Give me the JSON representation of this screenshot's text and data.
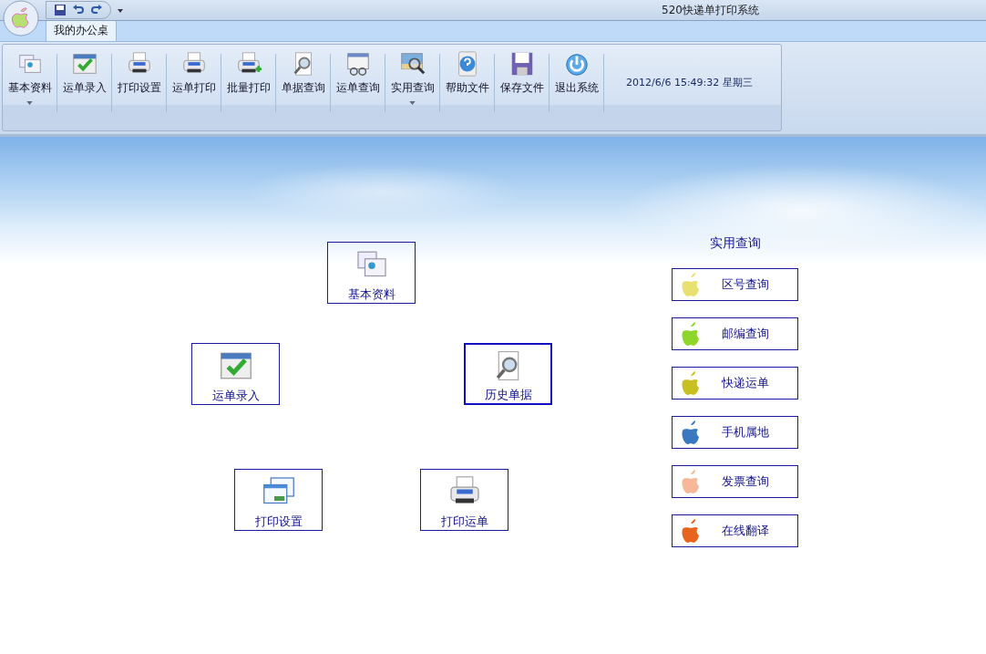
{
  "window": {
    "title": "520快递单打印系统"
  },
  "tabs": [
    {
      "label": "我的办公桌",
      "selected": true
    }
  ],
  "ribbon": {
    "buttons": [
      {
        "label": "基本资料",
        "has_menu": true
      },
      {
        "label": "运单录入",
        "has_menu": false
      },
      {
        "label": "打印设置",
        "has_menu": false
      },
      {
        "label": "运单打印",
        "has_menu": false
      },
      {
        "label": "批量打印",
        "has_menu": false
      },
      {
        "label": "单据查询",
        "has_menu": false
      },
      {
        "label": "运单查询",
        "has_menu": false
      },
      {
        "label": "实用查询",
        "has_menu": true
      },
      {
        "label": "帮助文件",
        "has_menu": false
      },
      {
        "label": "保存文件",
        "has_menu": false
      },
      {
        "label": "退出系统",
        "has_menu": false
      }
    ],
    "datetime": "2012/6/6 15:49:32 星期三"
  },
  "tiles": [
    {
      "label": "基本资料",
      "selected": false
    },
    {
      "label": "运单录入",
      "selected": false
    },
    {
      "label": "历史单据",
      "selected": true
    },
    {
      "label": "打印设置",
      "selected": false
    },
    {
      "label": "打印运单",
      "selected": false
    }
  ],
  "tools": {
    "title": "实用查询",
    "items": [
      {
        "label": "区号查询",
        "color": "#e8e070"
      },
      {
        "label": "邮编查询",
        "color": "#8ed62a"
      },
      {
        "label": "快递运单",
        "color": "#c8c020"
      },
      {
        "label": "手机属地",
        "color": "#3a78c0"
      },
      {
        "label": "发票查询",
        "color": "#f6b898"
      },
      {
        "label": "在线翻译",
        "color": "#e8641e"
      }
    ]
  }
}
